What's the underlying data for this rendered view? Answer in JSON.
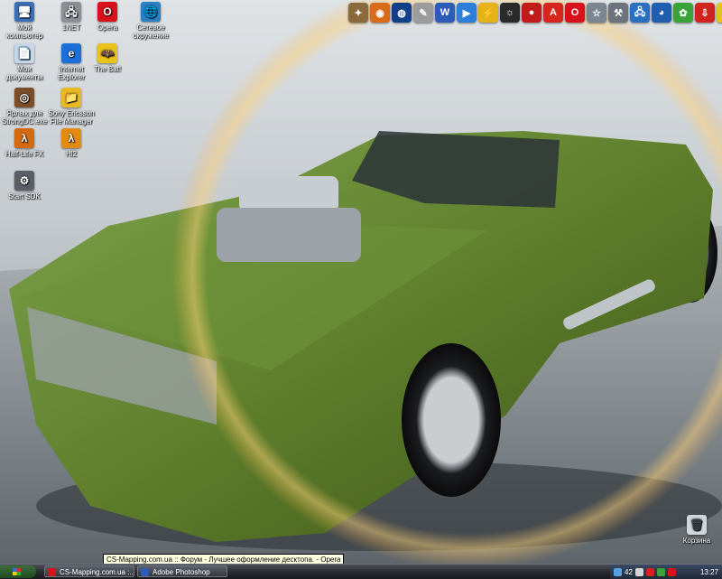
{
  "desktop_icons": [
    {
      "name": "my-computer-icon",
      "label": "Мой компьютер",
      "glyph": "🖥",
      "color": "#3b6fb6"
    },
    {
      "name": "1net-icon",
      "label": "1NET",
      "glyph": "🖧",
      "color": "#8a8f96"
    },
    {
      "name": "opera-icon",
      "label": "Opera",
      "glyph": "O",
      "color": "#d9111d"
    },
    {
      "name": "network-places-icon",
      "label": "Сетевое окружение",
      "glyph": "🌐",
      "color": "#2b7fc4"
    },
    {
      "name": "my-documents-icon",
      "label": "Мои документы",
      "glyph": "📄",
      "color": "#c8d6ea"
    },
    {
      "name": "internet-explorer-icon",
      "label": "Internet Explorer",
      "glyph": "e",
      "color": "#1d6fd8"
    },
    {
      "name": "the-bat-icon",
      "label": "The Bat!",
      "glyph": "🦇",
      "color": "#e8c31a"
    },
    {
      "name": "strongdc-icon",
      "label": "Ярлык для StrongDC.exe",
      "glyph": "◎",
      "color": "#7a4e2a"
    },
    {
      "name": "file-manager-icon",
      "label": "Sony Ericsson File Manager",
      "glyph": "📁",
      "color": "#e8b923"
    },
    {
      "name": "half-life-fx-icon",
      "label": "Half-Life FX",
      "glyph": "λ",
      "color": "#d46a10"
    },
    {
      "name": "hl2-icon",
      "label": "Hl2",
      "glyph": "λ",
      "color": "#e48a10"
    },
    {
      "name": "start-sdk-icon",
      "label": "Start SDK",
      "glyph": "⚙",
      "color": "#5a5f66"
    }
  ],
  "recycle_bin": {
    "label": "Корзина"
  },
  "quick_launch": [
    {
      "name": "counter-strike-icon",
      "glyph": "✦",
      "color": "#8a6a3a"
    },
    {
      "name": "firefox-icon",
      "glyph": "◉",
      "color": "#d86a18"
    },
    {
      "name": "web-icon",
      "glyph": "◍",
      "color": "#123f8a"
    },
    {
      "name": "pen-icon",
      "glyph": "✎",
      "color": "#9c9c9c"
    },
    {
      "name": "word-icon",
      "glyph": "W",
      "color": "#2c5bb8"
    },
    {
      "name": "media-player-icon",
      "glyph": "▶",
      "color": "#2c7fd8"
    },
    {
      "name": "flashget-icon",
      "glyph": "⚡",
      "color": "#e7b11a"
    },
    {
      "name": "winamp-icon",
      "glyph": "☼",
      "color": "#2a2a2a"
    },
    {
      "name": "nero-icon",
      "glyph": "●",
      "color": "#c21b1b"
    },
    {
      "name": "acrobat-icon",
      "glyph": "A",
      "color": "#d7261e"
    },
    {
      "name": "opera-icon",
      "glyph": "O",
      "color": "#d9111d"
    },
    {
      "name": "star-icon",
      "glyph": "☆",
      "color": "#7a8590"
    },
    {
      "name": "tools-icon",
      "glyph": "⚒",
      "color": "#6c737c"
    },
    {
      "name": "network-icon",
      "glyph": "🖧",
      "color": "#2a6fc0"
    },
    {
      "name": "globe-icon",
      "glyph": "◕",
      "color": "#1e5fb0"
    },
    {
      "name": "icq-icon",
      "glyph": "✿",
      "color": "#3aa43a"
    },
    {
      "name": "download-icon",
      "glyph": "⇩",
      "color": "#d0251e"
    },
    {
      "name": "settings-icon",
      "glyph": "✧",
      "color": "#e4c222"
    }
  ],
  "tooltip": "CS-Mapping.com.ua :: Форум - Лучшее оформление десктопа. - Opera",
  "taskbar": {
    "tasks": [
      {
        "name": "taskbar-opera",
        "label": "CS-Mapping.com.ua :...",
        "color": "#d9111d"
      },
      {
        "name": "taskbar-photoshop",
        "label": "Adobe Photoshop",
        "color": "#2c5bb8"
      }
    ],
    "tray_text": "42",
    "clock": "13:27"
  }
}
